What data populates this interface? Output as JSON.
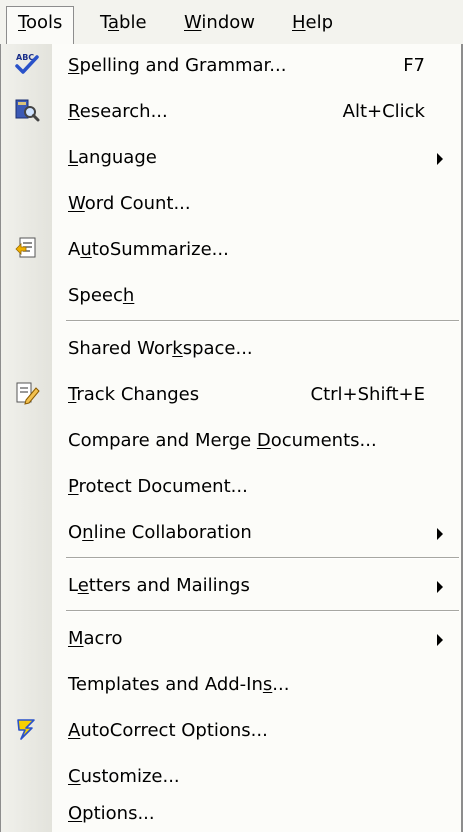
{
  "menubar": {
    "items": [
      {
        "label": "Tools",
        "mnemonic": 0
      },
      {
        "label": "Table",
        "mnemonic": 1
      },
      {
        "label": "Window",
        "mnemonic": 0
      },
      {
        "label": "Help",
        "mnemonic": 0
      }
    ]
  },
  "menu": {
    "items": [
      {
        "label": "Spelling and Grammar...",
        "mnemonic": 0,
        "shortcut": "F7",
        "icon": "spelling-grammar-icon"
      },
      {
        "label": "Research...",
        "mnemonic": 0,
        "shortcut": "Alt+Click",
        "icon": "research-icon"
      },
      {
        "label": "Language",
        "mnemonic": 0,
        "submenu": true
      },
      {
        "label": "Word Count...",
        "mnemonic": 0
      },
      {
        "label": "AutoSummarize...",
        "mnemonic": 1,
        "icon": "autosummarize-icon"
      },
      {
        "label": "Speech",
        "mnemonic": 5
      },
      {
        "label": "Shared Workspace...",
        "mnemonic": 10
      },
      {
        "label": "Track Changes",
        "mnemonic": 0,
        "shortcut": "Ctrl+Shift+E",
        "icon": "track-changes-icon"
      },
      {
        "label": "Compare and Merge Documents...",
        "mnemonic": 18
      },
      {
        "label": "Protect Document...",
        "mnemonic": 0
      },
      {
        "label": "Online Collaboration",
        "mnemonic": 1,
        "submenu": true
      },
      {
        "label": "Letters and Mailings",
        "mnemonic": 1,
        "submenu": true
      },
      {
        "label": "Macro",
        "mnemonic": 0,
        "submenu": true
      },
      {
        "label": "Templates and Add-Ins...",
        "mnemonic": 20
      },
      {
        "label": "AutoCorrect Options...",
        "mnemonic": 0,
        "icon": "autocorrect-icon"
      },
      {
        "label": "Customize...",
        "mnemonic": 0
      },
      {
        "label": "Options...",
        "mnemonic": 0
      }
    ]
  },
  "colors": {
    "menubar_bg": "#f3f3ee",
    "menu_bg": "#fcfcf9",
    "icon_strip": "#e3e3dc",
    "separator": "#a7a7a2",
    "border": "#8d8d8d"
  }
}
